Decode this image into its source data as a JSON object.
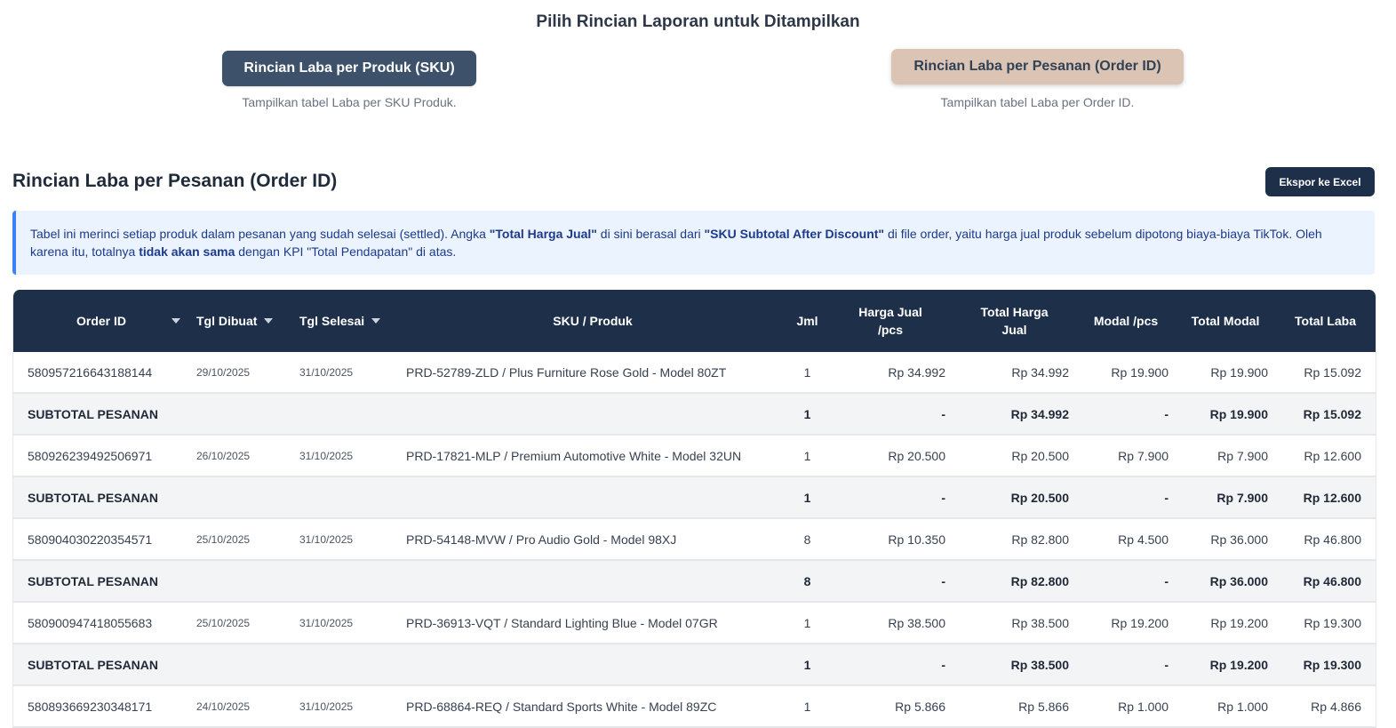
{
  "selector": {
    "title": "Pilih Rincian Laporan untuk Ditampilkan",
    "option_sku": {
      "label": "Rincian Laba per Produk (SKU)",
      "desc": "Tampilkan tabel Laba per SKU Produk."
    },
    "option_order": {
      "label": "Rincian Laba per Pesanan (Order ID)",
      "desc": "Tampilkan tabel Laba per Order ID."
    }
  },
  "section": {
    "title": "Rincian Laba per Pesanan (Order ID)",
    "export_label": "Ekspor ke Excel"
  },
  "info": {
    "t1": "Tabel ini merinci setiap produk dalam pesanan yang sudah selesai (settled). Angka ",
    "b1": "\"Total Harga Jual\"",
    "t2": " di sini berasal dari ",
    "b2": "\"SKU Subtotal After Discount\"",
    "t3": " di file order, yaitu harga jual produk sebelum dipotong biaya-biaya TikTok. Oleh karena itu, totalnya ",
    "b3": "tidak akan sama",
    "t4": " dengan KPI \"Total Pendapatan\" di atas."
  },
  "table": {
    "headers": {
      "order_id": "Order ID",
      "tgl_dibuat": "Tgl Dibuat",
      "tgl_selesai": "Tgl Selesai",
      "sku": "SKU / Produk",
      "jml": "Jml",
      "harga_jual_1": "Harga Jual",
      "harga_jual_2": "/pcs",
      "total_harga_1": "Total Harga",
      "total_harga_2": "Jual",
      "modal_pcs": "Modal /pcs",
      "total_modal": "Total Modal",
      "total_laba": "Total Laba"
    },
    "rows": [
      {
        "order_id": "580957216643188144",
        "dibuat": "29/10/2025",
        "selesai": "31/10/2025",
        "sku": "PRD-52789-ZLD / Plus Furniture Rose Gold - Model 80ZT",
        "jml": "1",
        "harga": "Rp 34.992",
        "total_harga": "Rp 34.992",
        "modal": "Rp 19.900",
        "total_modal": "Rp 19.900",
        "laba": "Rp 15.092"
      },
      {
        "label": "SUBTOTAL PESANAN",
        "jml": "1",
        "harga": "-",
        "total_harga": "Rp 34.992",
        "modal": "-",
        "total_modal": "Rp 19.900",
        "laba": "Rp 15.092"
      },
      {
        "order_id": "580926239492506971",
        "dibuat": "26/10/2025",
        "selesai": "31/10/2025",
        "sku": "PRD-17821-MLP / Premium Automotive White - Model 32UN",
        "jml": "1",
        "harga": "Rp 20.500",
        "total_harga": "Rp 20.500",
        "modal": "Rp 7.900",
        "total_modal": "Rp 7.900",
        "laba": "Rp 12.600"
      },
      {
        "label": "SUBTOTAL PESANAN",
        "jml": "1",
        "harga": "-",
        "total_harga": "Rp 20.500",
        "modal": "-",
        "total_modal": "Rp 7.900",
        "laba": "Rp 12.600"
      },
      {
        "order_id": "580904030220354571",
        "dibuat": "25/10/2025",
        "selesai": "31/10/2025",
        "sku": "PRD-54148-MVW / Pro Audio Gold - Model 98XJ",
        "jml": "8",
        "harga": "Rp 10.350",
        "total_harga": "Rp 82.800",
        "modal": "Rp 4.500",
        "total_modal": "Rp 36.000",
        "laba": "Rp 46.800"
      },
      {
        "label": "SUBTOTAL PESANAN",
        "jml": "8",
        "harga": "-",
        "total_harga": "Rp 82.800",
        "modal": "-",
        "total_modal": "Rp 36.000",
        "laba": "Rp 46.800"
      },
      {
        "order_id": "580900947418055683",
        "dibuat": "25/10/2025",
        "selesai": "31/10/2025",
        "sku": "PRD-36913-VQT / Standard Lighting Blue - Model 07GR",
        "jml": "1",
        "harga": "Rp 38.500",
        "total_harga": "Rp 38.500",
        "modal": "Rp 19.200",
        "total_modal": "Rp 19.200",
        "laba": "Rp 19.300"
      },
      {
        "label": "SUBTOTAL PESANAN",
        "jml": "1",
        "harga": "-",
        "total_harga": "Rp 38.500",
        "modal": "-",
        "total_modal": "Rp 19.200",
        "laba": "Rp 19.300"
      },
      {
        "order_id": "580893669230348171",
        "dibuat": "24/10/2025",
        "selesai": "31/10/2025",
        "sku": "PRD-68864-REQ / Standard Sports White - Model 89ZC",
        "jml": "1",
        "harga": "Rp 5.866",
        "total_harga": "Rp 5.866",
        "modal": "Rp 1.000",
        "total_modal": "Rp 1.000",
        "laba": "Rp 4.866"
      }
    ]
  }
}
